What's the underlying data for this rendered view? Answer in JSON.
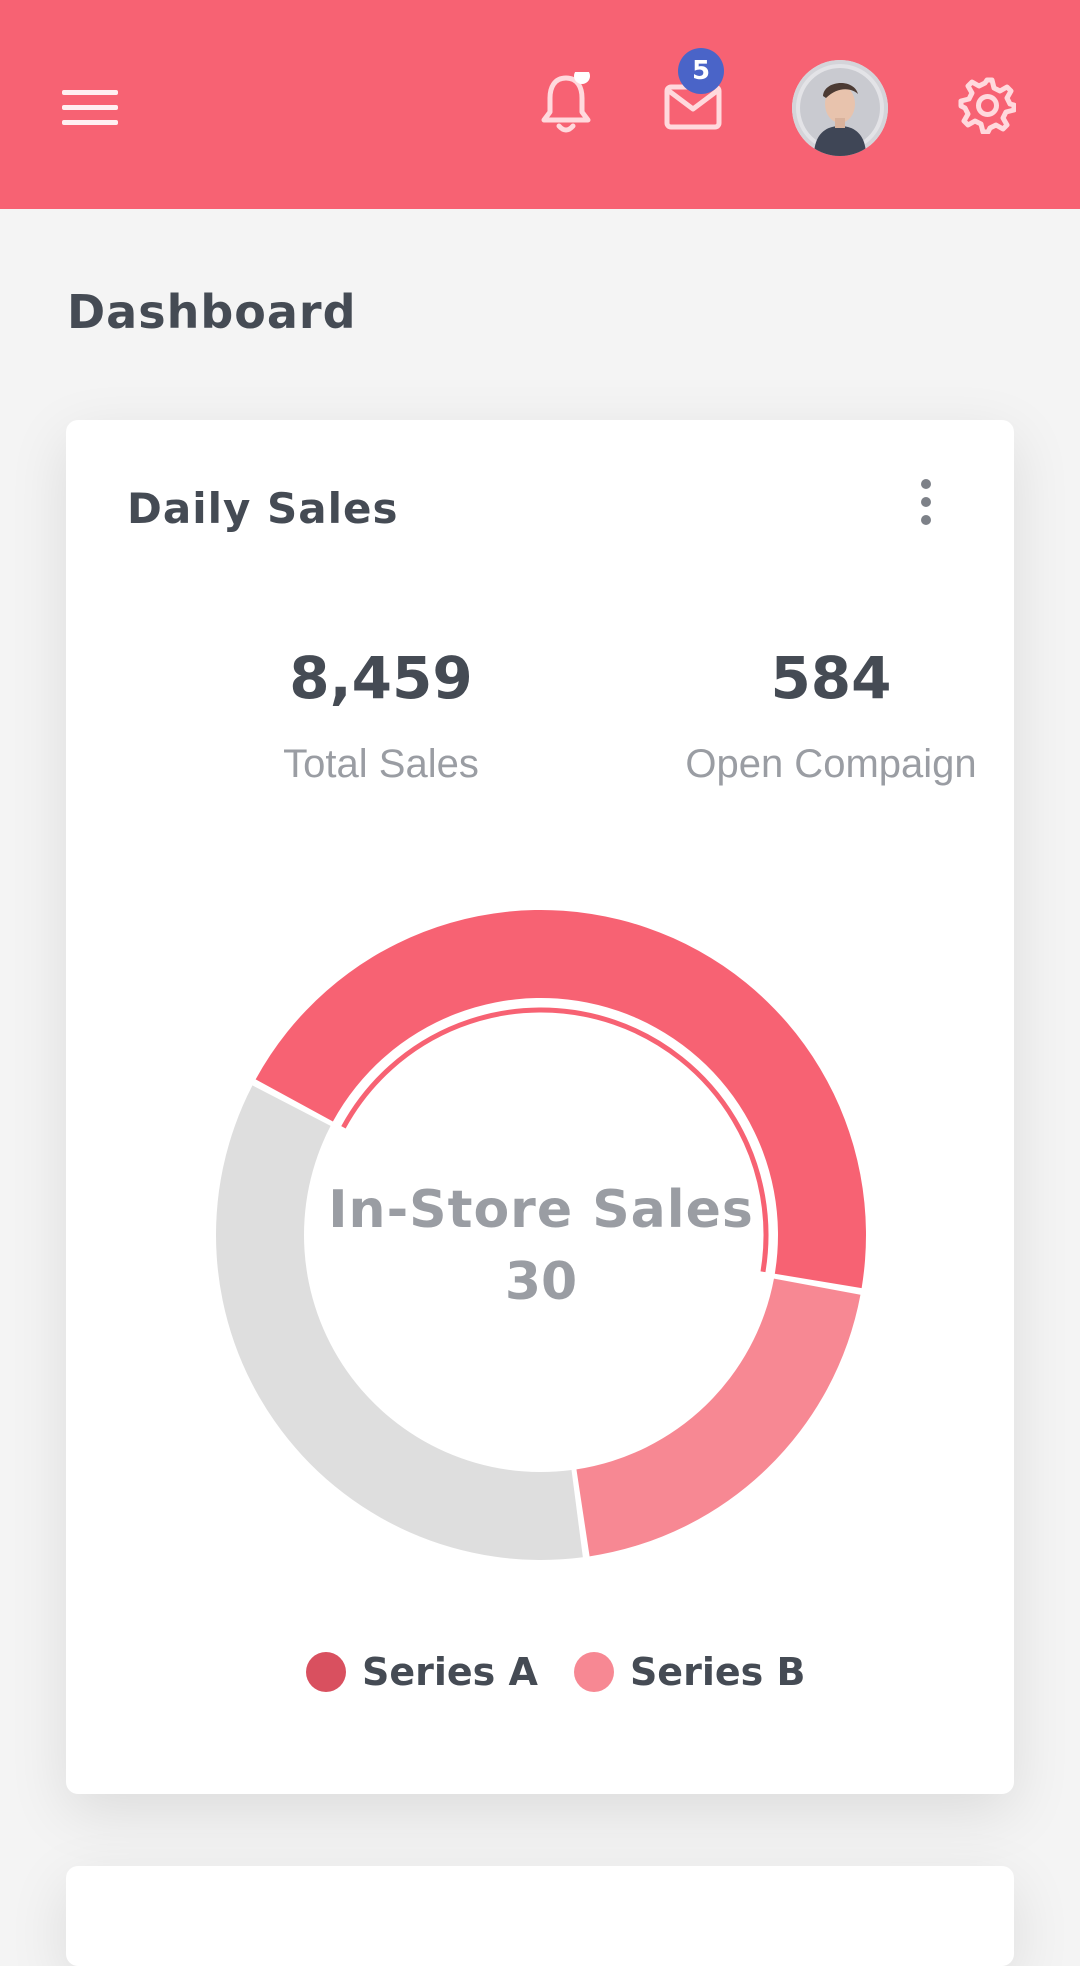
{
  "header": {
    "notifications_dot": true,
    "messages_badge": "5",
    "icons": [
      "menu-icon",
      "bell-icon",
      "mail-icon",
      "avatar",
      "gear-icon"
    ],
    "accent_color": "#f76273"
  },
  "page": {
    "title": "Dashboard"
  },
  "card": {
    "title": "Daily Sales",
    "stats": [
      {
        "value": "8,459",
        "label": "Total Sales"
      },
      {
        "value": "584",
        "label": "Open Compaign"
      }
    ],
    "donut_center": {
      "label": "In-Store Sales",
      "value": "30"
    },
    "legend": [
      {
        "label": "Series A",
        "color": "#d9505f"
      },
      {
        "label": "Series B",
        "color": "#f78893"
      }
    ]
  },
  "chart_data": {
    "type": "pie",
    "slices": [
      {
        "label": "Series A",
        "value": 45,
        "color": "#f76273"
      },
      {
        "label": "Series B",
        "value": 20,
        "color": "#f78893"
      },
      {
        "label": "",
        "value": 35,
        "color": "#dedede"
      }
    ],
    "center_text": "In-Store Sales 30"
  }
}
